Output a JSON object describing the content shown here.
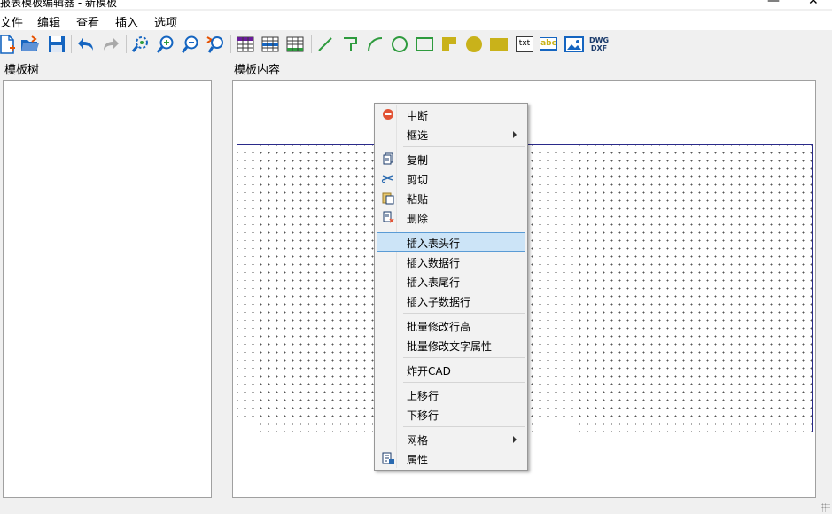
{
  "window": {
    "title": "报表模板编辑器 - 新模板",
    "minimize_glyph": "—",
    "close_glyph": "✕"
  },
  "menubar": {
    "items": [
      "文件",
      "编辑",
      "查看",
      "插入",
      "选项"
    ]
  },
  "toolbar": {
    "icons": [
      "new-file-icon",
      "open-folder-icon",
      "save-icon",
      "undo-icon",
      "redo-icon",
      "zoom-extents-icon",
      "zoom-in-icon",
      "zoom-out-icon",
      "zoom-previous-icon",
      "table-header-icon",
      "table-data-icon",
      "table-footer-icon",
      "line-icon",
      "polyline-icon",
      "arc-icon",
      "circle-icon",
      "rectangle-icon",
      "solid-fill-icon",
      "filled-circle-icon",
      "filled-rectangle-icon",
      "text-icon",
      "attribute-text-icon",
      "image-icon",
      "dwg-dxf-icon"
    ],
    "text_label": "txt",
    "attr_label": "abc",
    "dwg_label": "DWG",
    "dxf_label": "DXF"
  },
  "panels": {
    "tree_title": "模板树",
    "content_title": "模板内容"
  },
  "context_menu": {
    "items": {
      "interrupt": "中断",
      "box_select": "框选",
      "copy": "复制",
      "cut": "剪切",
      "paste": "粘贴",
      "delete": "删除",
      "insert_header_row": "插入表头行",
      "insert_data_row": "插入数据行",
      "insert_footer_row": "插入表尾行",
      "insert_child_data_row": "插入子数据行",
      "batch_row_height": "批量修改行高",
      "batch_text_props": "批量修改文字属性",
      "explode_cad": "炸开CAD",
      "move_row_up": "上移行",
      "move_row_down": "下移行",
      "grid": "网格",
      "properties": "属性"
    },
    "highlighted": "insert_header_row"
  },
  "colors": {
    "accent_highlight": "#cce4f7",
    "highlight_border": "#5a9bd5",
    "toolbar_blue": "#1565c0",
    "toolbar_green": "#2e9b3e",
    "toolbar_yellow": "#c9b21a",
    "table_dark": "#3a3a3a"
  }
}
